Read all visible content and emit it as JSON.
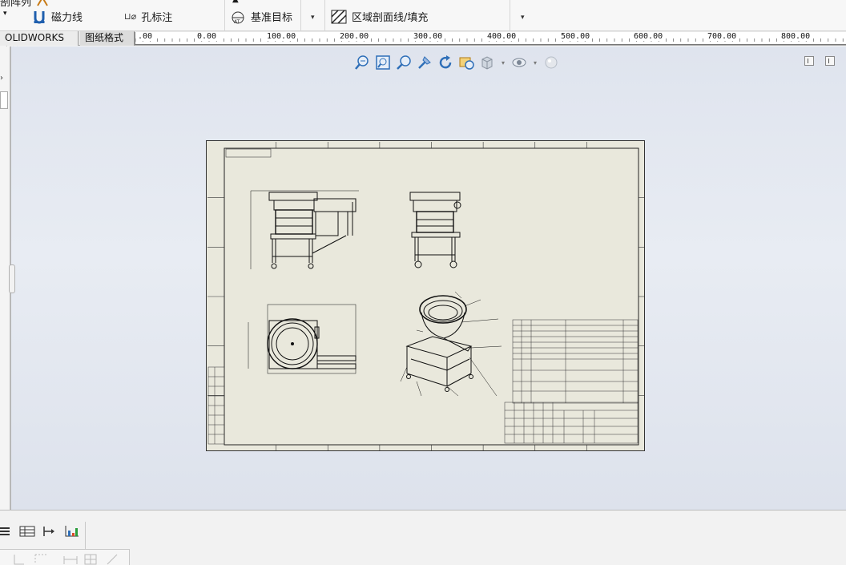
{
  "ribbon": {
    "row1_left": "剖阵列",
    "magnet_line": "磁力线",
    "hole_callout": "孔标注",
    "datum_target": "基准目标",
    "area_hatch": "区域剖面线/填充"
  },
  "tabs": [
    {
      "label": "OLIDWORKS 插件"
    },
    {
      "label": "图纸格式"
    }
  ],
  "ruler": {
    "labels": [
      ".00",
      "0.00",
      "100.00",
      "200.00",
      "300.00",
      "400.00",
      "500.00",
      "600.00",
      "700.00",
      "800.00"
    ]
  },
  "icons": {
    "view_tools": [
      "zoom-to-fit-icon",
      "zoom-to-area-icon",
      "zoom-in-out-icon",
      "pan-icon",
      "rotate-icon",
      "redraw-icon",
      "display-style-icon",
      "hide-show-icon",
      "appearance-icon"
    ],
    "bottom_tools": [
      "list-icon",
      "table-icon",
      "flip-icon",
      "chart-icon"
    ]
  },
  "colors": {
    "sheet_bg": "#e9e8dc",
    "canvas_top": "#dfe4ee",
    "accent_blue": "#2f6fb8"
  }
}
